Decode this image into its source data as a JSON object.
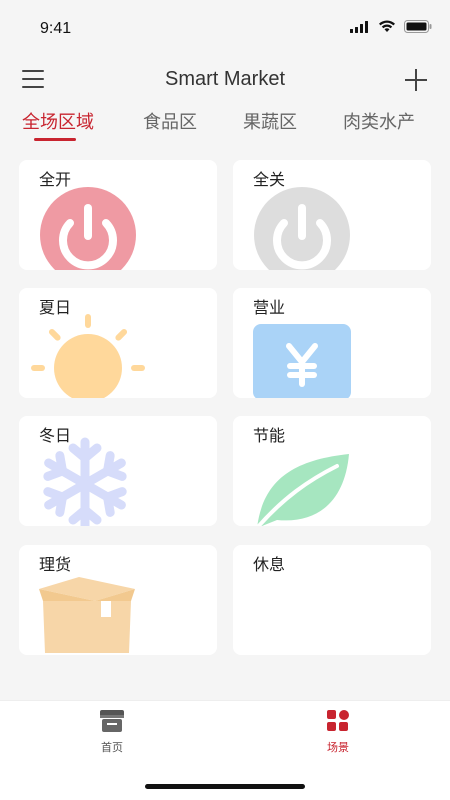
{
  "status_bar": {
    "time": "9:41"
  },
  "header": {
    "title": "Smart Market"
  },
  "tabs": [
    {
      "label": "全场区域",
      "active": true
    },
    {
      "label": "食品区",
      "active": false
    },
    {
      "label": "果蔬区",
      "active": false
    },
    {
      "label": "肉类水产",
      "active": false
    }
  ],
  "scenes": [
    {
      "label": "全开",
      "icon": "power-on-icon"
    },
    {
      "label": "全关",
      "icon": "power-off-icon"
    },
    {
      "label": "夏日",
      "icon": "sun-icon"
    },
    {
      "label": "营业",
      "icon": "yen-icon"
    },
    {
      "label": "冬日",
      "icon": "snowflake-icon"
    },
    {
      "label": "节能",
      "icon": "leaf-icon"
    },
    {
      "label": "理货",
      "icon": "box-icon"
    },
    {
      "label": "休息",
      "icon": "moon-icon"
    }
  ],
  "bottom_nav": [
    {
      "label": "首页",
      "icon": "store-icon",
      "active": false
    },
    {
      "label": "场景",
      "icon": "grid-icon",
      "active": true
    }
  ],
  "colors": {
    "accent": "#c8242f",
    "power_on": "#ef9aa3",
    "power_off": "#dddddd",
    "sun": "#ffd89b",
    "yen": "#aad3f7",
    "snow": "#d6dcfa",
    "leaf": "#a6e6c0",
    "box": "#f7d6a8",
    "moon": "#c5cafa"
  }
}
